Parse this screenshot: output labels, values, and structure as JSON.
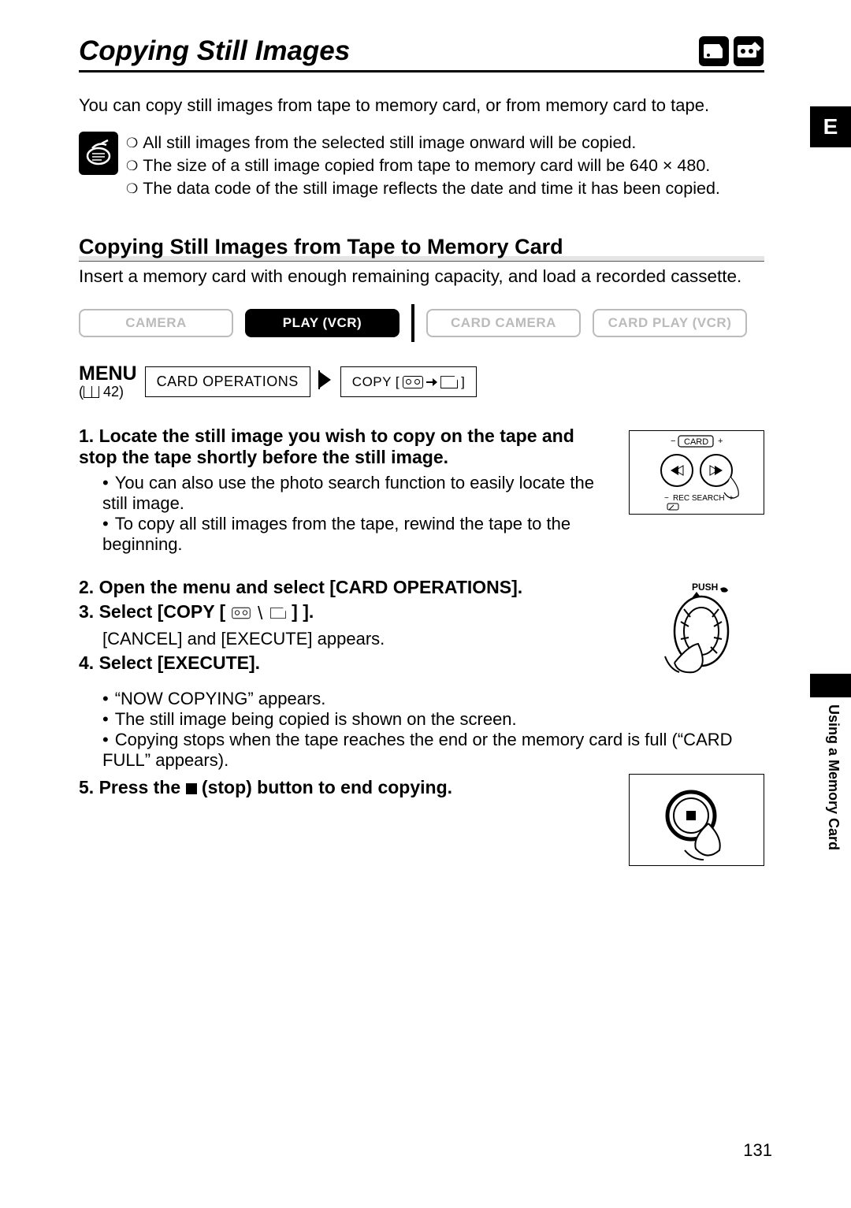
{
  "title": "Copying Still Images",
  "intro": "You can copy still images from tape to memory card, or from memory card to tape.",
  "notes": [
    "All still images from the selected still image onward will be copied.",
    "The size of a still image copied from tape to memory card will be 640 × 480.",
    "The data code of the still image reflects the date and time it has been copied."
  ],
  "section1": {
    "heading": "Copying Still Images from Tape to Memory Card",
    "sub": "Insert a memory card with enough remaining capacity, and load a recorded cassette."
  },
  "modes": {
    "camera": "CAMERA",
    "play_vcr": "PLAY (VCR)",
    "card_camera": "CARD CAMERA",
    "card_play_vcr": "CARD PLAY (VCR)"
  },
  "menu": {
    "label": "MENU",
    "ref": "42",
    "box1": "CARD OPERATIONS",
    "box2_prefix": "COPY ["
  },
  "steps": {
    "s1_head": "1. Locate the still image you wish to copy on the tape and stop the tape shortly before the still image.",
    "s1_b1": "You can also use the photo search function to easily locate the still image.",
    "s1_b2": "To copy all still images from the tape, rewind the tape to the beginning.",
    "s2_head": "2. Open the menu and select [CARD OPERATIONS].",
    "s3_head": "3. Select [COPY [",
    "s3_tail": "] ].",
    "s3_sub": "[CANCEL] and [EXECUTE] appears.",
    "s4_head": "4. Select [EXECUTE].",
    "s4_b1": "“NOW COPYING” appears.",
    "s4_b2": "The still image being copied is shown on the screen.",
    "s4_b3": "Copying stops when the tape reaches the end or the memory card is full (“CARD FULL” appears).",
    "s5_head_a": "5. Press the ",
    "s5_head_b": " (stop) button to end copying."
  },
  "side": {
    "e": "E",
    "label": "Using a Memory Card"
  },
  "illus": {
    "card_minus": "−",
    "card_plus": "+",
    "card_label": "CARD",
    "rec_minus": "−",
    "rec_plus": "+",
    "rec_search": "REC SEARCH",
    "push": "PUSH"
  },
  "page_number": "131",
  "icons": {
    "card_top": "card-icon",
    "tape_top": "tape-pen-icon",
    "notes": "notes-icon"
  }
}
